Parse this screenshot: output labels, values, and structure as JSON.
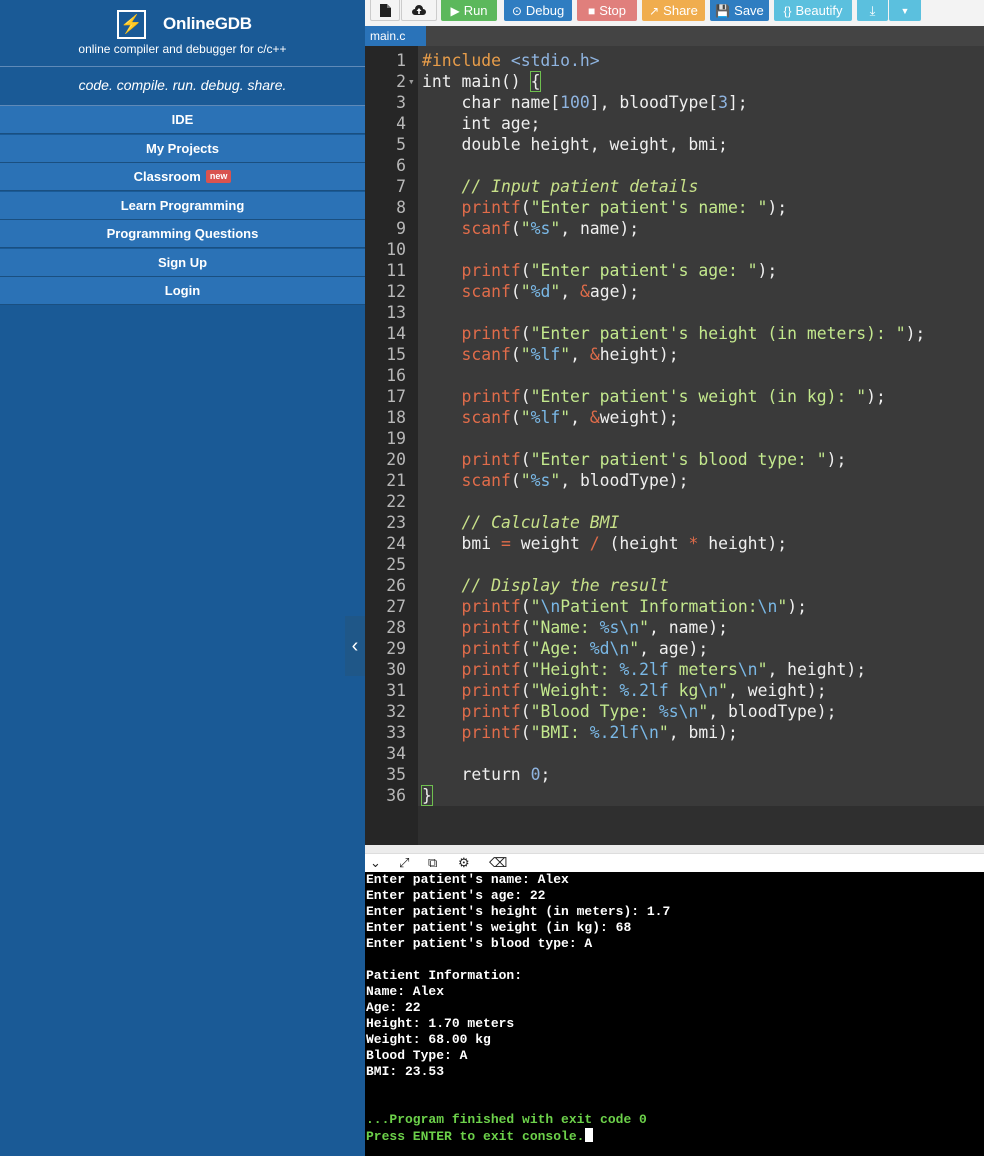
{
  "sidebar": {
    "logo_glyph": "⚡",
    "brand": "OnlineGDB",
    "subtitle": "online compiler and debugger for c/c++",
    "tagline": "code. compile. run. debug. share.",
    "nav": [
      {
        "label": "IDE"
      },
      {
        "label": "My Projects"
      },
      {
        "label": "Classroom",
        "badge": "new"
      },
      {
        "label": "Learn Programming"
      },
      {
        "label": "Programming Questions"
      },
      {
        "label": "Sign Up"
      },
      {
        "label": "Login"
      }
    ],
    "collapse_glyph": "‹"
  },
  "toolbar": {
    "new_file_icon": "file-icon",
    "open_icon": "upload-icon",
    "run": "Run",
    "debug": "Debug",
    "stop": "Stop",
    "share": "Share",
    "save": "Save",
    "beautify": "Beautify",
    "colors": {
      "run": "#5cb85c",
      "debug": "#2f7dc1",
      "stop": "#d9534f",
      "share": "#f0ad4e",
      "save": "#2f7dc1",
      "beautify": "#5bc0de",
      "download": "#5bc0de"
    }
  },
  "tabs": [
    {
      "label": "main.c"
    }
  ],
  "code_lines": [
    "#include <stdio.h>",
    "int main() {",
    "    char name[100], bloodType[3];",
    "    int age;",
    "    double height, weight, bmi;",
    "",
    "    // Input patient details",
    "    printf(\"Enter patient's name: \");",
    "    scanf(\"%s\", name);",
    "",
    "    printf(\"Enter patient's age: \");",
    "    scanf(\"%d\", &age);",
    "",
    "    printf(\"Enter patient's height (in meters): \");",
    "    scanf(\"%lf\", &height);",
    "",
    "    printf(\"Enter patient's weight (in kg): \");",
    "    scanf(\"%lf\", &weight);",
    "",
    "    printf(\"Enter patient's blood type: \");",
    "    scanf(\"%s\", bloodType);",
    "",
    "    // Calculate BMI",
    "    bmi = weight / (height * height);",
    "",
    "    // Display the result",
    "    printf(\"\\nPatient Information:\\n\");",
    "    printf(\"Name: %s\\n\", name);",
    "    printf(\"Age: %d\\n\", age);",
    "    printf(\"Height: %.2lf meters\\n\", height);",
    "    printf(\"Weight: %.2lf kg\\n\", weight);",
    "    printf(\"Blood Type: %s\\n\", bloodType);",
    "    printf(\"BMI: %.2lf\\n\", bmi);",
    "",
    "    return 0;",
    "}"
  ],
  "console": {
    "lines": [
      "Enter patient's name: Alex",
      "Enter patient's age: 22",
      "Enter patient's height (in meters): 1.7",
      "Enter patient's weight (in kg): 68",
      "Enter patient's blood type: A",
      "",
      "Patient Information:",
      "Name: Alex",
      "Age: 22",
      "Height: 1.70 meters",
      "Weight: 68.00 kg",
      "Blood Type: A",
      "BMI: 23.53",
      "",
      "",
      "...Program finished with exit code 0",
      "Press ENTER to exit console."
    ],
    "status_colors": {
      "normal": "#ffffff",
      "finished": "#6cd14a"
    }
  }
}
